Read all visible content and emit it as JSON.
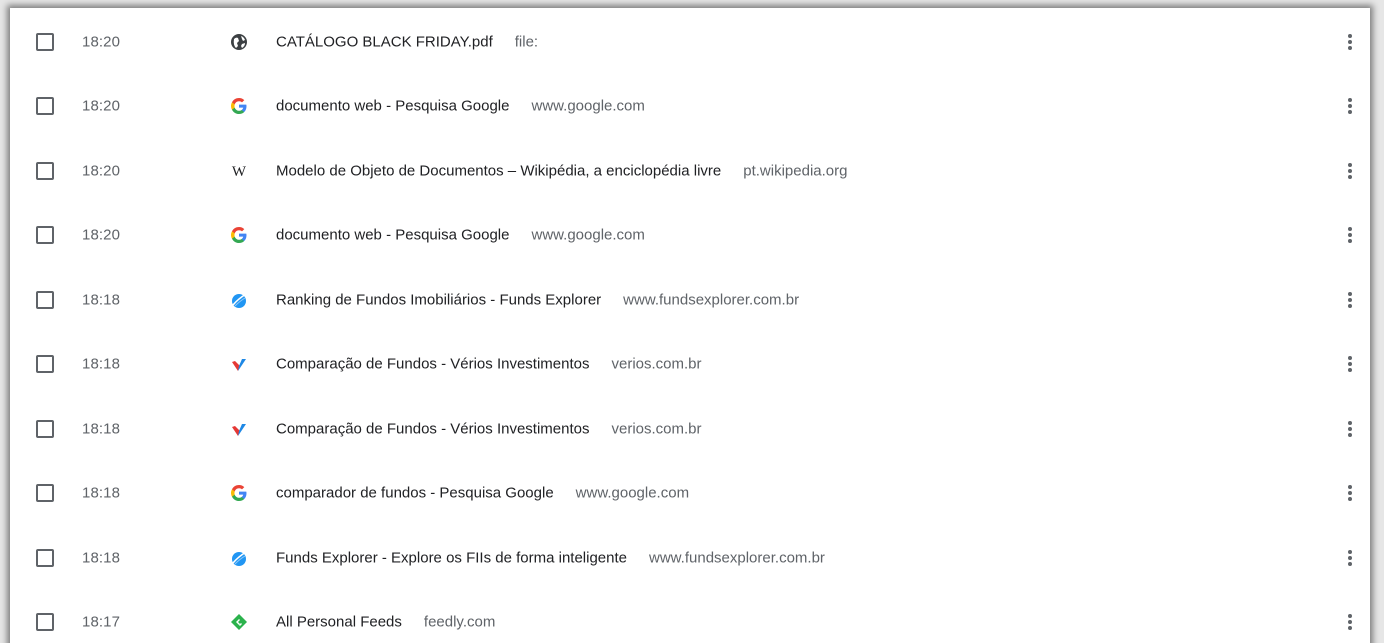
{
  "history": {
    "rows": [
      {
        "time": "18:20",
        "icon": "globe-icon",
        "title": "CATÁLOGO BLACK FRIDAY.pdf",
        "domain": "file:"
      },
      {
        "time": "18:20",
        "icon": "google-icon",
        "title": "documento web - Pesquisa Google",
        "domain": "www.google.com"
      },
      {
        "time": "18:20",
        "icon": "wikipedia-icon",
        "title": "Modelo de Objeto de Documentos – Wikipédia, a enciclopédia livre",
        "domain": "pt.wikipedia.org"
      },
      {
        "time": "18:20",
        "icon": "google-icon",
        "title": "documento web - Pesquisa Google",
        "domain": "www.google.com"
      },
      {
        "time": "18:18",
        "icon": "funds-explorer-icon",
        "title": "Ranking de Fundos Imobiliários - Funds Explorer",
        "domain": "www.fundsexplorer.com.br"
      },
      {
        "time": "18:18",
        "icon": "verios-icon",
        "title": "Comparação de Fundos - Vérios Investimentos",
        "domain": "verios.com.br"
      },
      {
        "time": "18:18",
        "icon": "verios-icon",
        "title": "Comparação de Fundos - Vérios Investimentos",
        "domain": "verios.com.br"
      },
      {
        "time": "18:18",
        "icon": "google-icon",
        "title": "comparador de fundos - Pesquisa Google",
        "domain": "www.google.com"
      },
      {
        "time": "18:18",
        "icon": "funds-explorer-icon",
        "title": "Funds Explorer - Explore os FIIs de forma inteligente",
        "domain": "www.fundsexplorer.com.br"
      },
      {
        "time": "18:17",
        "icon": "feedly-icon",
        "title": "All Personal Feeds",
        "domain": "feedly.com"
      }
    ]
  },
  "colors": {
    "text_primary": "#202124",
    "text_secondary": "#5f6368",
    "google_blue": "#4285f4",
    "google_red": "#ea4335",
    "google_yellow": "#fbbc05",
    "google_green": "#34a853",
    "funds_blue": "#2196f3",
    "verios_red": "#e53935",
    "verios_blue": "#1e88e5",
    "feedly_green": "#2bb24c"
  }
}
